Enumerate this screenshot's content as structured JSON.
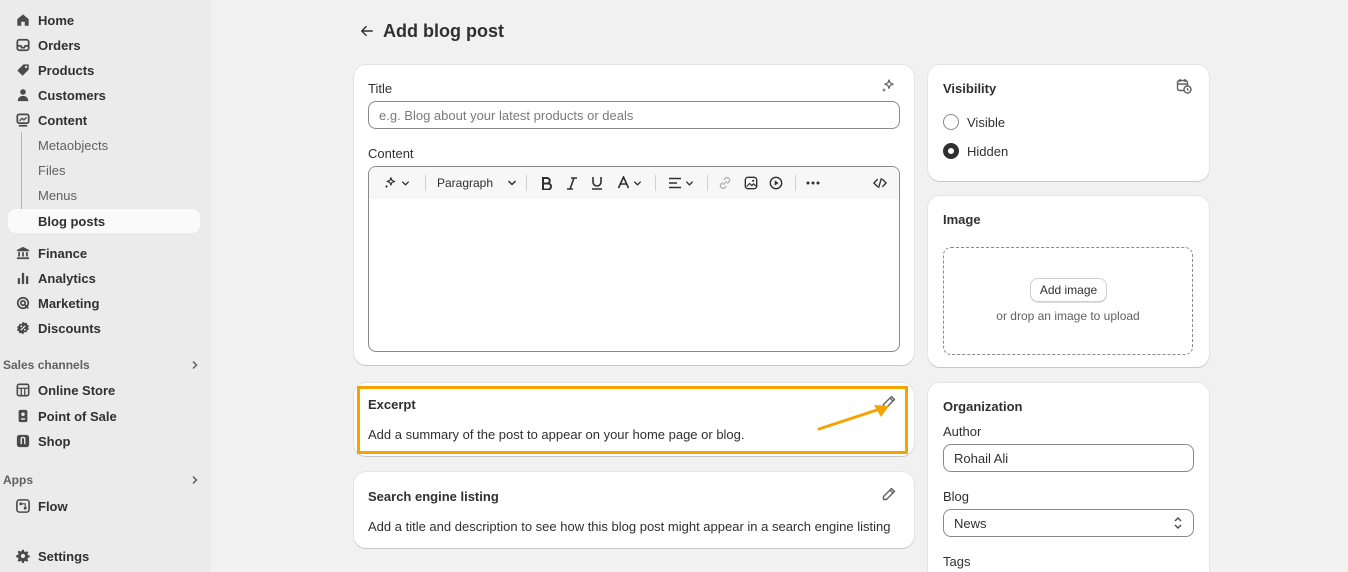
{
  "sidebar": {
    "items": [
      {
        "label": "Home",
        "icon": "home-icon"
      },
      {
        "label": "Orders",
        "icon": "orders-icon"
      },
      {
        "label": "Products",
        "icon": "tag-icon"
      },
      {
        "label": "Customers",
        "icon": "person-icon"
      },
      {
        "label": "Content",
        "icon": "content-icon"
      }
    ],
    "content_sub": [
      "Metaobjects",
      "Files",
      "Menus",
      "Blog posts"
    ],
    "more_items": [
      {
        "label": "Finance",
        "icon": "bank-icon"
      },
      {
        "label": "Analytics",
        "icon": "chart-bar-icon"
      },
      {
        "label": "Marketing",
        "icon": "target-icon"
      },
      {
        "label": "Discounts",
        "icon": "discount-icon"
      }
    ],
    "sales_channels_label": "Sales channels",
    "channels": [
      {
        "label": "Online Store",
        "icon": "store-icon"
      },
      {
        "label": "Point of Sale",
        "icon": "pos-icon"
      },
      {
        "label": "Shop",
        "icon": "shop-icon"
      }
    ],
    "apps_label": "Apps",
    "apps": [
      {
        "label": "Flow",
        "icon": "flow-icon"
      }
    ],
    "settings_label": "Settings"
  },
  "header": {
    "title": "Add blog post"
  },
  "main": {
    "title_label": "Title",
    "title_placeholder": "e.g. Blog about your latest products or deals",
    "content_label": "Content",
    "toolbar": {
      "paragraph_label": "Paragraph"
    },
    "excerpt": {
      "title": "Excerpt",
      "description": "Add a summary of the post to appear on your home page or blog."
    },
    "seo": {
      "title": "Search engine listing",
      "description": "Add a title and description to see how this blog post might appear in a search engine listing"
    }
  },
  "side": {
    "visibility": {
      "title": "Visibility",
      "options": [
        "Visible",
        "Hidden"
      ],
      "selected": "Hidden"
    },
    "image": {
      "title": "Image",
      "add_button": "Add image",
      "hint": "or drop an image to upload"
    },
    "organization": {
      "title": "Organization",
      "author_label": "Author",
      "author_value": "Rohail Ali",
      "blog_label": "Blog",
      "blog_value": "News",
      "tags_label": "Tags"
    }
  },
  "colors": {
    "highlight": "#f5a300",
    "sidebar_bg": "#ebebeb",
    "page_bg": "#f1f1f1"
  }
}
